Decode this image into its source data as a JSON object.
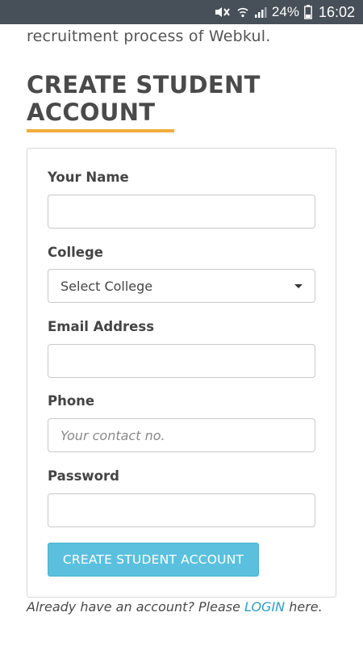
{
  "status_bar": {
    "battery_percent": "24%",
    "time": "16:02",
    "icons": [
      "mute-icon",
      "wifi-icon",
      "signal-icon",
      "battery-icon"
    ]
  },
  "intro_text": "recruitment process of Webkul.",
  "heading": "CREATE STUDENT ACCOUNT",
  "form": {
    "name_label": "Your Name",
    "name_value": "",
    "college_label": "College",
    "college_selected": "Select College",
    "email_label": "Email Address",
    "email_value": "",
    "phone_label": "Phone",
    "phone_placeholder": "Your contact no.",
    "password_label": "Password",
    "password_value": "",
    "submit_label": "CREATE STUDENT ACCOUNT"
  },
  "footer": {
    "prefix": "Already have an account? Please ",
    "link": "LOGIN",
    "suffix": " here."
  },
  "colors": {
    "status_bar": "#475059",
    "accent_underline": "#f0ad3c",
    "button": "#5bc0de",
    "link": "#2a9fc7"
  }
}
